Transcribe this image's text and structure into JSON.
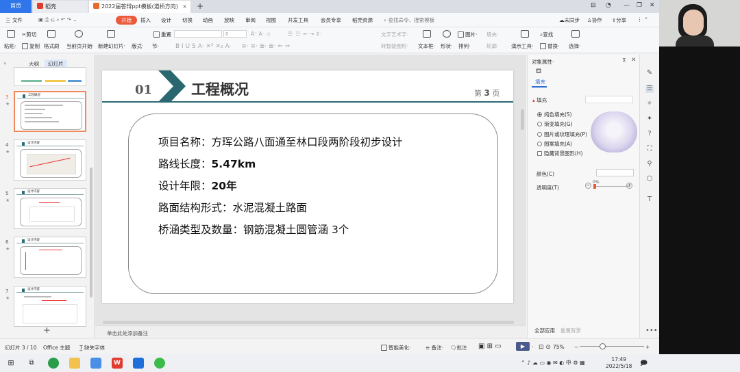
{
  "tabs": {
    "home": "首页",
    "wps": "稻壳",
    "doc": "2022届答辩ppt模板(道桥方向)",
    "add": "+"
  },
  "window": {
    "minimize": "—",
    "restore": "❐",
    "close": "✕"
  },
  "menu": {
    "file": "三 文件",
    "items": [
      "开始",
      "插入",
      "设计",
      "切换",
      "动画",
      "放映",
      "审阅",
      "视图",
      "开发工具",
      "会员专享",
      "稻壳资源"
    ],
    "search": "查找命令、搜索模板",
    "sync": "未同步",
    "collab": "协作",
    "share": "分享"
  },
  "toolbar": {
    "paste": "粘贴·",
    "cut": "剪切",
    "copy": "复制",
    "format_painter": "格式刷",
    "current_page_start": "当前页开始·",
    "new_slide": "新建幻灯片·",
    "layout": "版式·",
    "section": "节·",
    "reset": "重置",
    "font_size": "0",
    "text_box": "文本框·",
    "shape": "形状·",
    "arrange": "排列·",
    "picture": "图片·",
    "fill": "填充·",
    "outline": "轮廓·",
    "text_tool": "文字艺术字·",
    "smart_shape": "转智能图形·",
    "presentation_tools": "演示工具·",
    "find": "查找",
    "replace": "替换·",
    "select": "选择·"
  },
  "left_panel": {
    "outline_tab": "大纲",
    "slides_tab": "幻灯片",
    "thumbnails": [
      {
        "num": "3",
        "title": "工程概况"
      },
      {
        "num": "4",
        "title": "设计内容"
      },
      {
        "num": "5",
        "title": "设计内容"
      },
      {
        "num": "6",
        "title": "设计内容"
      },
      {
        "num": "7",
        "title": "设计内容"
      }
    ],
    "add": "+"
  },
  "slide": {
    "section_num": "01",
    "title": "工程概况",
    "page_prefix": "第",
    "page_num": "3",
    "page_suffix": "页",
    "rows": [
      {
        "label": "项目名称：",
        "value": "方珲公路八面通至林口段两阶段初步设计"
      },
      {
        "label": "路线长度：",
        "value": "5.47km"
      },
      {
        "label": "设计年限：",
        "value": "20年"
      },
      {
        "label": "路面结构形式：",
        "value": "水泥混凝土路面"
      },
      {
        "label": "桥涵类型及数量：",
        "value": "钢筋混凝土圆管涵 3个"
      }
    ],
    "colors": {
      "accent": "#2b6771",
      "title": "#333333"
    }
  },
  "notes": {
    "placeholder": "单击此处添加备注"
  },
  "right_panel": {
    "title": "对象属性·",
    "fill_tab": "填充",
    "section": "填充",
    "options": [
      "纯色填充(S)",
      "渐变填充(G)",
      "图片或纹理填充(P)",
      "图案填充(A)"
    ],
    "hide_bg": "隐藏背景图形(H)",
    "color_label": "颜色(C)",
    "transparency_label": "透明度(T)",
    "transparency_value": "0%",
    "apply_all": "全部应用",
    "reset_bg": "重置背景"
  },
  "status": {
    "slide_info": "幻灯片 3 / 10",
    "theme": "Office 主题",
    "missing_font": "缺失字体",
    "smart_beautify": "智能美化·",
    "notes": "备注·",
    "comments": "批注",
    "zoom": "75%"
  },
  "taskbar": {
    "time": "17:49",
    "date": "2022/5/18",
    "ime": "中"
  }
}
